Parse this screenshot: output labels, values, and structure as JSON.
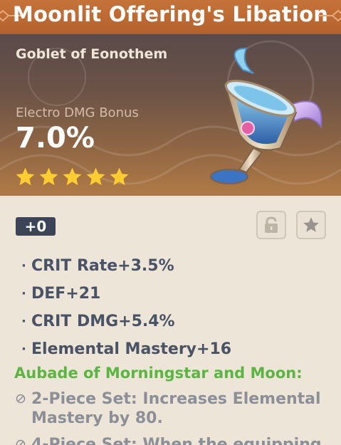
{
  "artifact": {
    "name": "Moonlit Offering's Libation",
    "piece_type": "Goblet of Eonothem",
    "main_stat": {
      "label": "Electro DMG Bonus",
      "value": "7.0%"
    },
    "rarity": 5,
    "level": "+0",
    "icons": {
      "goblet": "goblet-image",
      "lock": "lock-icon",
      "favorite": "star-icon",
      "rarity_star": "star-icon"
    },
    "substats": [
      "CRIT Rate+3.5%",
      "DEF+21",
      "CRIT DMG+5.4%",
      "Elemental Mastery+16"
    ],
    "set": {
      "name": "Aubade of Morningstar and Moon:",
      "bonus_2": "2-Piece Set: Increases Elemental Mastery by 80.",
      "bonus_4": "4-Piece Set: When the equipping"
    }
  },
  "colors": {
    "title_bar": "#bc6832",
    "set_name": "#5cb543",
    "substat_text": "#4a5266",
    "level_badge": "#3c4558",
    "rarity_star": "#ffcc32",
    "panel_bg": "#ece5d8"
  }
}
